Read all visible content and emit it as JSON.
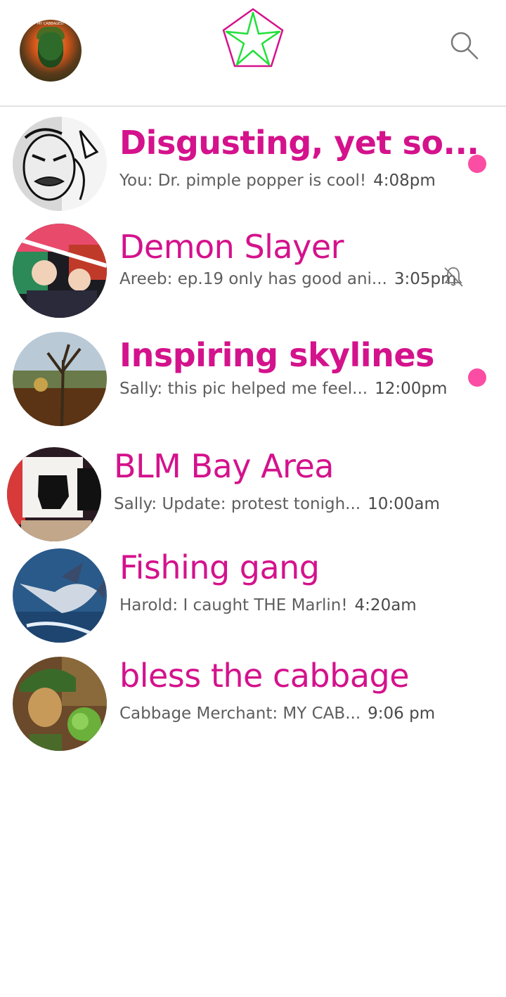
{
  "header": {
    "profile_caption": "MY CABBAGES!",
    "logo_icon": "star-pentagon-logo-icon",
    "search_icon": "search-icon",
    "colors": {
      "accent": "#d4128c",
      "logo_star": "#22e03a",
      "unread": "#fb4da3"
    }
  },
  "chats": [
    {
      "title": "Disgusting, yet so...",
      "sender": "You",
      "message": "Dr. pimple popper is cool!",
      "time": "4:08pm",
      "unread": true,
      "muted": false
    },
    {
      "title": "Demon Slayer",
      "sender": "Areeb",
      "message": "ep.19 only has good ani...",
      "time": "3:05pm",
      "unread": false,
      "muted": true
    },
    {
      "title": "Inspiring skylines",
      "sender": "Sally",
      "message": "this pic helped me feel...",
      "time": "12:00pm",
      "unread": true,
      "muted": false
    },
    {
      "title": "BLM Bay Area",
      "sender": "Sally",
      "message": "Update: protest tonigh...",
      "time": "10:00am",
      "unread": false,
      "muted": false
    },
    {
      "title": "Fishing gang",
      "sender": "Harold",
      "message": "I caught THE Marlin!",
      "time": "4:20am",
      "unread": false,
      "muted": false
    },
    {
      "title": "bless the cabbage",
      "sender": "Cabbage Merchant",
      "message": "MY CAB...",
      "time": "9:06 pm",
      "unread": false,
      "muted": false
    }
  ],
  "preview_texts": [
    "You: Dr. pimple popper is cool!",
    "Areeb: ep.19 only has good ani...",
    "Sally: this pic helped me feel...",
    "Sally: Update: protest tonigh...",
    "Harold: I caught THE Marlin!",
    "Cabbage Merchant: MY CAB..."
  ]
}
